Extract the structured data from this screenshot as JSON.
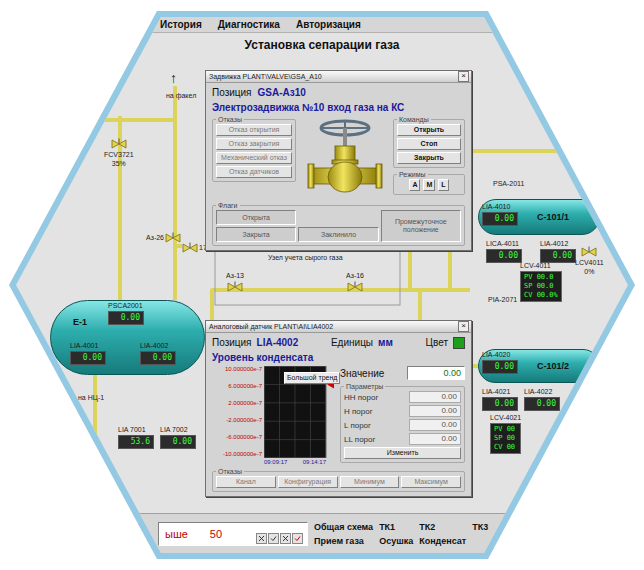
{
  "menu": [
    {
      "label": "История"
    },
    {
      "label": "Диагностика"
    },
    {
      "label": "Авторизация"
    }
  ],
  "title": "Установка сепарации газа",
  "vessels": [
    {
      "name": "Е-1"
    },
    {
      "name": "С-101/1"
    },
    {
      "name": "С-101/2"
    }
  ],
  "instruments": [
    {
      "tag": "PSCA2001",
      "value": "0.00"
    },
    {
      "tag": "LIA-4001",
      "value": "0.00"
    },
    {
      "tag": "LIA-4002",
      "value": "0.00"
    },
    {
      "tag": "LIA 7001",
      "value": "53.6"
    },
    {
      "tag": "LIA 7002",
      "value": "0.00"
    },
    {
      "tag": "LIA-4010",
      "value": "0.00"
    },
    {
      "tag": "LICA-4011",
      "value": "0.00"
    },
    {
      "tag": "LIA-4012",
      "value": "0.00"
    },
    {
      "tag": "LIA-4020",
      "value": "0.00"
    },
    {
      "tag": "LIA-4021",
      "value": "0.00"
    },
    {
      "tag": "LIA-4022",
      "value": "0.00"
    }
  ],
  "controllers": [
    {
      "tag": "LCV-4011",
      "lines": [
        "PV 00.0",
        "SP 00.0",
        "CV 00.0%"
      ]
    },
    {
      "tag": "LCV-4021",
      "lines": [
        "PV 00",
        "SP 00",
        "CV 00"
      ]
    }
  ],
  "valves": [
    {
      "tag": "FCV3721",
      "reading": "35%"
    },
    {
      "tag": "LCV4011",
      "reading": "0%"
    },
    {
      "tag": "Аз-26"
    },
    {
      "tag": "17"
    },
    {
      "tag": "Аз-13"
    },
    {
      "tag": "Аз-16"
    }
  ],
  "labels": [
    {
      "text": "на факел"
    },
    {
      "text": "↑"
    },
    {
      "text": "Узел учета сырого газа"
    },
    {
      "text": "PSA-2011"
    },
    {
      "text": "PIA-2071"
    },
    {
      "text": "110"
    },
    {
      "text": "на НЦ-1"
    }
  ],
  "valve_dialog": {
    "title": "Задвижка PLANT\\VALVE\\GSA_A10",
    "close": "×",
    "position_label": "Позиция",
    "position": "GSA-Аз10",
    "description": "Электрозадвижка №10 вход газа на КС",
    "faults_title": "Отказы",
    "faults": [
      {
        "label": "Отказ открытия",
        "disabled": true
      },
      {
        "label": "Отказ закрытия",
        "disabled": true
      },
      {
        "label": "Механический отказ",
        "disabled": true
      },
      {
        "label": "Отказ датчиков",
        "disabled": true
      }
    ],
    "commands_title": "Команды",
    "commands": [
      {
        "label": "Открыть",
        "disabled": false
      },
      {
        "label": "Стоп",
        "disabled": false
      },
      {
        "label": "Закрыть",
        "disabled": false
      }
    ],
    "modes_title": "Режимы",
    "modes": [
      {
        "label": "A",
        "selected": false
      },
      {
        "label": "M",
        "selected": false
      },
      {
        "label": "L",
        "selected": false
      }
    ],
    "flags_title": "Флаги",
    "flags": [
      {
        "label": "Открыта",
        "on": false
      },
      {
        "label": "Закрыта",
        "on": false
      },
      {
        "label": "Заклинило",
        "on": false
      },
      {
        "label": "Промежуточное положение",
        "on": false
      }
    ]
  },
  "analog_dialog": {
    "title": "Аналоговый датчик PLANT\\AI\\LIA4002",
    "close": "×",
    "position_label": "Позиция",
    "position": "LIA-4002",
    "units_label": "Единицы",
    "units": "мм",
    "color_label": "Цвет",
    "color": "#1aa01a",
    "description": "Уровень конденсата",
    "chart": {
      "y_labels": [
        "10.000000e-7",
        "6.000000e-7",
        "2.000000e-7",
        "-2.000000e-7",
        "-6.000000e-7",
        "-10.000000e-7"
      ],
      "times": [
        "09:09:17",
        "09:14:17"
      ],
      "range": [
        -1e-06,
        1e-06
      ],
      "marker": 6e-07,
      "series": [],
      "trend_button": "Большой тренд"
    },
    "value_label": "Значение",
    "value": "0.00",
    "params_title": "Параметры",
    "params": [
      {
        "label": "HH порог",
        "value": "0.00"
      },
      {
        "label": "H порог",
        "value": "0.00"
      },
      {
        "label": "L порог",
        "value": "0.00"
      },
      {
        "label": "LL порог",
        "value": "0.00"
      }
    ],
    "change_button": "Изменить",
    "faults_title": "Отказы",
    "faults": [
      {
        "label": "Канал",
        "disabled": true
      },
      {
        "label": "Конфигурация",
        "disabled": true
      },
      {
        "label": "Минимум",
        "disabled": true
      },
      {
        "label": "Максимум",
        "disabled": true
      }
    ]
  },
  "alarm": {
    "text": "ыше",
    "value": "50"
  },
  "nav": [
    {
      "label": "Общая схема",
      "selected": false
    },
    {
      "label": "ТК1",
      "selected": false
    },
    {
      "label": "ТК2",
      "selected": false
    },
    {
      "label": "ТК3",
      "selected": false
    },
    {
      "label": "Прием газа",
      "selected": false
    },
    {
      "label": "Осушка",
      "selected": false
    },
    {
      "label": "Конденсат",
      "selected": false
    }
  ]
}
